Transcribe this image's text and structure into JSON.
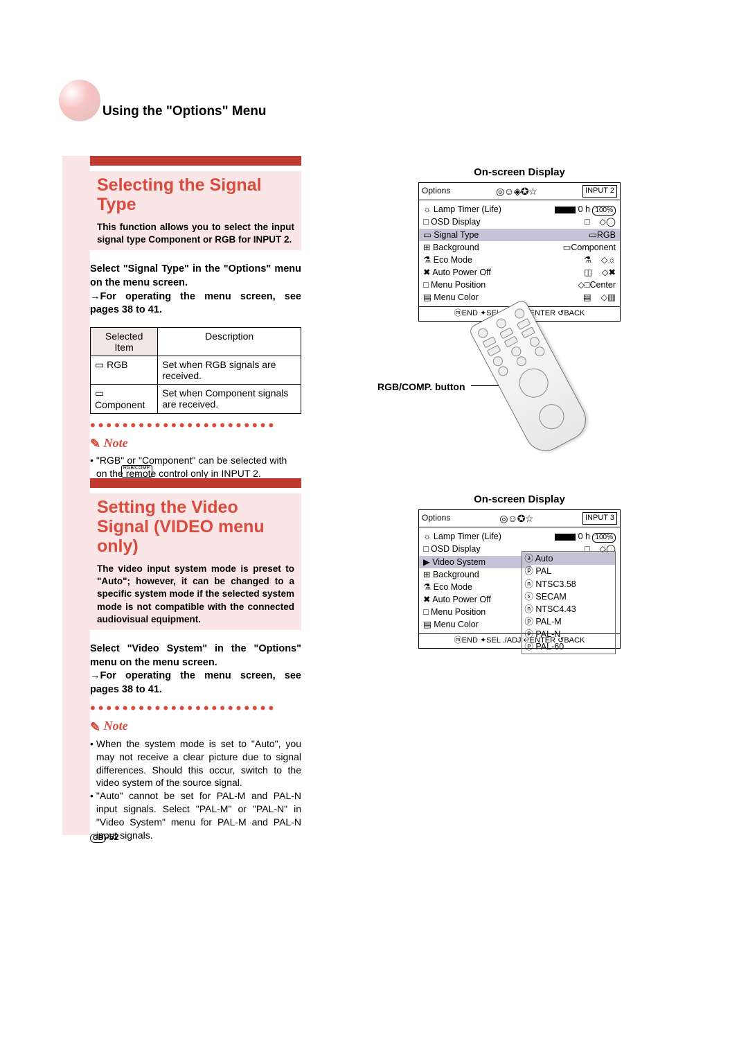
{
  "header": {
    "title": "Using the \"Options\" Menu"
  },
  "section1": {
    "title": "Selecting the Signal Type",
    "intro": "This function allows you to select the input signal type Component or RGB for INPUT 2.",
    "step": "Select \"Signal Type\" in the \"Options\" menu on the menu screen.",
    "ref": "→For operating the menu screen, see pages 38 to 41.",
    "table": {
      "headers": [
        "Selected Item",
        "Description"
      ],
      "rows": [
        {
          "item": "▭ RGB",
          "desc": "Set when RGB signals are received."
        },
        {
          "item": "▭\nComponent",
          "desc": "Set when Component signals are received."
        }
      ]
    },
    "note_label": "Note",
    "note": "\"RGB\" or \"Component\" can be selected with      on the remote control only in INPUT 2.",
    "note_icon_label": "RGB/COMP."
  },
  "section2": {
    "title": "Setting the Video Signal (VIDEO menu only)",
    "intro": "The video input system mode is preset to \"Auto\"; however, it can be changed to a specific system mode if the selected system mode is not compatible with the connected audiovisual equipment.",
    "step": "Select \"Video System\" in the \"Options\" menu on the menu screen.",
    "ref": "→For operating the menu screen, see pages 38 to 41.",
    "note_label": "Note",
    "notes": [
      "When the system mode is set to \"Auto\", you may not receive a clear picture due to signal differences. Should this occur, switch to the video system of the source signal.",
      "\"Auto\" cannot be set for PAL-M and PAL-N input signals. Select \"PAL-M\" or \"PAL-N\" in \"Video System\" menu for PAL-M and PAL-N input signals."
    ]
  },
  "osd1": {
    "title": "On-screen Display",
    "menu_label": "Options",
    "input_label": "INPUT 2",
    "rows": [
      {
        "l": "☼ Lamp Timer (Life)",
        "r_bar": true,
        "r": "0 h",
        "pct": "100%"
      },
      {
        "l": "□ OSD Display",
        "r": "□    ◇◯"
      },
      {
        "l": "▭ Signal Type",
        "r": "▭RGB",
        "selected": true
      },
      {
        "l": "⊞ Background",
        "r": "▭Component"
      },
      {
        "l": "⚗ Eco Mode",
        "r": "⚗    ◇☼"
      },
      {
        "l": "✖ Auto Power Off",
        "r": "◫    ◇✖"
      },
      {
        "l": "□ Menu Position",
        "r": "◇□Center"
      },
      {
        "l": "▤ Menu Color",
        "r": "▤    ◇▥"
      }
    ],
    "footer": "ⓜEND ✦SEL ./ADJ ↵ENTER ↺BACK"
  },
  "osd2": {
    "title": "On-screen Display",
    "menu_label": "Options",
    "input_label": "INPUT 3",
    "rows_left": [
      "☼ Lamp Timer (Life)",
      "□ OSD Display",
      "▶ Video System",
      "⊞ Background",
      "⚗ Eco Mode",
      "✖ Auto Power Off",
      "□ Menu Position",
      "▤ Menu Color"
    ],
    "rows_right_top": [
      {
        "bar": true,
        "txt": "0 h",
        "pct": "100%"
      },
      {
        "txt": "□    ◇◯"
      }
    ],
    "options_box": [
      "ⓐ Auto",
      "ⓟ PAL",
      "ⓝ NTSC3.58",
      "ⓢ SECAM",
      "ⓝ NTSC4.43",
      "ⓟ PAL-M",
      "ⓟ PAL-N",
      "ⓟ PAL-60"
    ],
    "footer": "ⓜEND ✦SEL ./ADJ ↵ENTER ↺BACK"
  },
  "remote_label": "RGB/COMP. button",
  "page_number": "-52",
  "page_region": "GB"
}
